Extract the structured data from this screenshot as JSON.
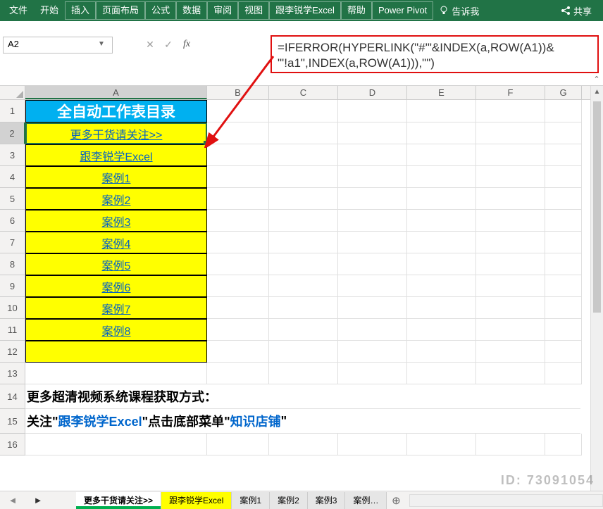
{
  "ribbon": {
    "tabs": [
      "文件",
      "开始",
      "插入",
      "页面布局",
      "公式",
      "数据",
      "审阅",
      "视图",
      "跟李锐学Excel",
      "帮助",
      "Power Pivot"
    ],
    "tellMe": "告诉我",
    "share": "共享"
  },
  "nameBox": {
    "value": "A2"
  },
  "formulaBar": {
    "line1": "=IFERROR(HYPERLINK(\"#'\"&INDEX(a,ROW(A1))&",
    "line2": "\"'!a1\",INDEX(a,ROW(A1))),\"\")"
  },
  "columns": [
    "A",
    "B",
    "C",
    "D",
    "E",
    "F",
    "G"
  ],
  "rowNums": [
    1,
    2,
    3,
    4,
    5,
    6,
    7,
    8,
    9,
    10,
    11,
    12,
    13,
    14,
    15,
    16
  ],
  "cells": {
    "A1": "全自动工作表目录",
    "A2": "更多干货请关注>>",
    "A3": "跟李锐学Excel",
    "A4": "案例1",
    "A5": "案例2",
    "A6": "案例3",
    "A7": "案例4",
    "A8": "案例5",
    "A9": "案例6",
    "A10": "案例7",
    "A11": "案例8"
  },
  "notes": {
    "line1": "更多超清视频系统课程获取方式：",
    "line2a": "关注\"",
    "line2b": "跟李锐学Excel",
    "line2c": "\"点击底部菜单\"",
    "line2d": "知识店铺",
    "line2e": "\""
  },
  "sheetTabs": [
    "更多干货请关注>>",
    "跟李锐学Excel",
    "案例1",
    "案例2",
    "案例3",
    "案例…"
  ],
  "watermark": "ID: 73091054"
}
